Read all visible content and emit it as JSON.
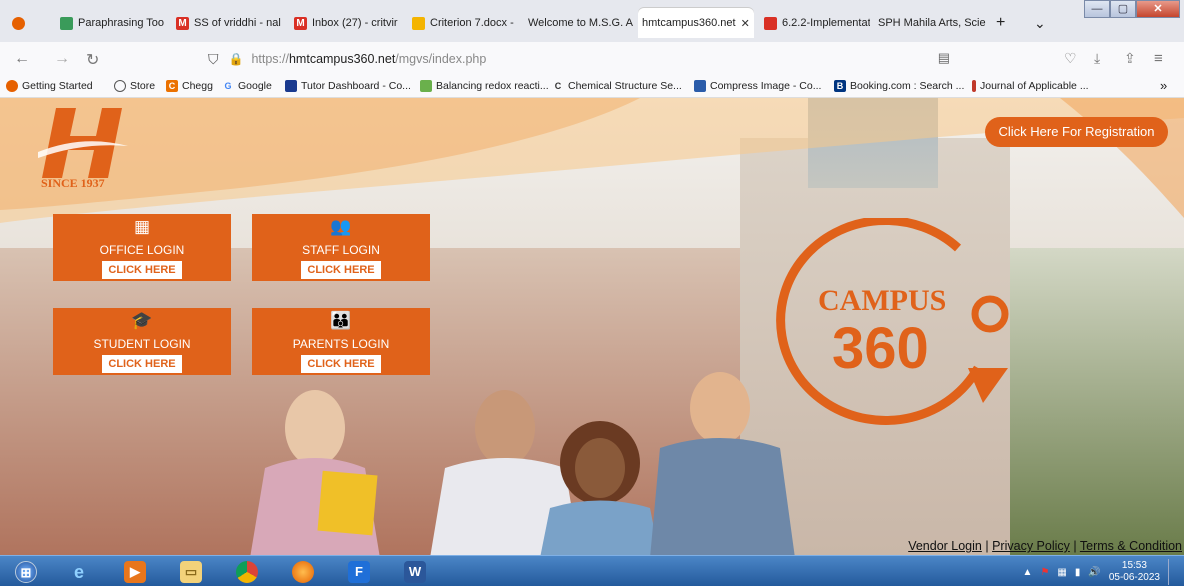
{
  "browser": {
    "tabs": [
      {
        "label": "Paraphrasing Too",
        "icon": "quillbot-icon",
        "color": "#3a9b5a"
      },
      {
        "label": "SS of vriddhi - nal",
        "icon": "gmail-icon",
        "color": "#d93025"
      },
      {
        "label": "Inbox (27) - critvir",
        "icon": "gmail-icon",
        "color": "#d93025"
      },
      {
        "label": "Criterion 7.docx -",
        "icon": "drive-icon",
        "color": "#f4b400"
      },
      {
        "label": "Welcome to M.S.G. A",
        "icon": "",
        "color": ""
      },
      {
        "label": "hmtcampus360.net",
        "icon": "",
        "color": ""
      },
      {
        "label": "6.2.2-Implementat",
        "icon": "doc-icon",
        "color": "#d93025"
      },
      {
        "label": "SPH Mahila Arts, Scie",
        "icon": "",
        "color": ""
      }
    ],
    "new_tab": "+",
    "tab_list": "⌄",
    "close_tab": "✕",
    "url_scheme": "https://",
    "url_host": "hmtcampus360.net",
    "url_path": "/mgvs/index.php",
    "bookmarks": [
      {
        "label": "Getting Started",
        "icon": "firefox-icon",
        "color": "#e66000"
      },
      {
        "label": "Store",
        "icon": "globe-icon",
        "color": ""
      },
      {
        "label": "Chegg",
        "icon": "chegg-icon",
        "color": "#eb7100"
      },
      {
        "label": "Google",
        "icon": "google-icon",
        "color": ""
      },
      {
        "label": "Tutor Dashboard - Co...",
        "icon": "tutor-icon",
        "color": "#1a3a8f"
      },
      {
        "label": "Balancing redox reacti...",
        "icon": "image-icon",
        "color": "#6ab04c"
      },
      {
        "label": "Chemical Structure Se...",
        "icon": "chemspider-icon",
        "color": ""
      },
      {
        "label": "Compress Image - Co...",
        "icon": "compress-icon",
        "color": "#2a5caa"
      },
      {
        "label": "Booking.com : Search ...",
        "icon": "booking-icon",
        "color": "#003580"
      },
      {
        "label": "Journal of Applicable ...",
        "icon": "journal-icon",
        "color": "#c0392b"
      }
    ],
    "overflow": "»"
  },
  "site": {
    "logo_text": "SINCE 1937",
    "brand_orange": "#e0621a",
    "registration_button": "Click Here For Registration",
    "tiles": [
      {
        "label": "OFFICE LOGIN",
        "button": "CLICK HERE",
        "icon": "building-icon"
      },
      {
        "label": "STAFF LOGIN",
        "button": "CLICK HERE",
        "icon": "group-icon"
      },
      {
        "label": "STUDENT LOGIN",
        "button": "CLICK HERE",
        "icon": "graduation-cap-icon"
      },
      {
        "label": "PARENTS LOGIN",
        "button": "CLICK HERE",
        "icon": "parents-icon"
      }
    ],
    "campus_logo_word": "CAMPUS",
    "campus_logo_number": "360",
    "footer": {
      "vendor": "Vendor Login",
      "privacy": "Privacy Policy",
      "terms": "Terms & Condition",
      "separator": "|"
    }
  },
  "taskbar": {
    "time": "15:53",
    "date": "05-06-2023",
    "apps": [
      "windows-start-icon",
      "ie-icon",
      "media-player-icon",
      "file-explorer-icon",
      "chrome-icon",
      "firefox-icon",
      "app-icon",
      "word-icon"
    ]
  }
}
